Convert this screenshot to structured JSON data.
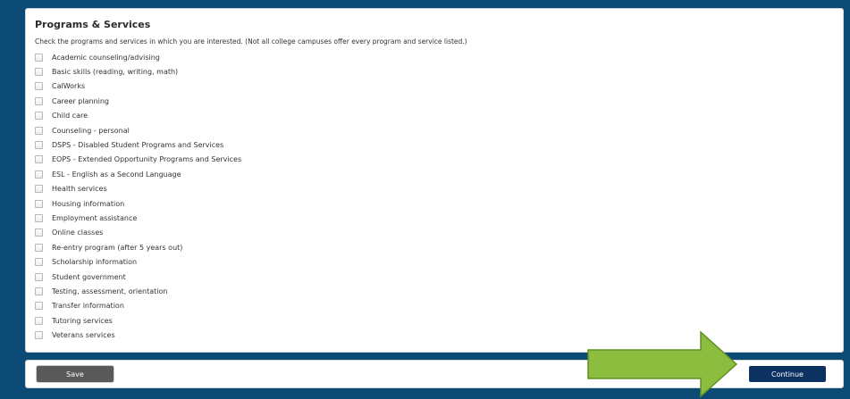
{
  "section": {
    "title": "Programs & Services",
    "intro": "Check the programs and services in which you are interested. (Not all college campuses offer every program and service listed.)",
    "options": [
      "Academic counseling/advising",
      "Basic skills (reading, writing, math)",
      "CalWorks",
      "Career planning",
      "Child care",
      "Counseling - personal",
      "DSPS - Disabled Student Programs and Services",
      "EOPS - Extended Opportunity Programs and Services",
      "ESL - English as a Second Language",
      "Health services",
      "Housing information",
      "Employment assistance",
      "Online classes",
      "Re-entry program (after 5 years out)",
      "Scholarship information",
      "Student government",
      "Testing, assessment, orientation",
      "Transfer information",
      "Tutoring services",
      "Veterans services"
    ]
  },
  "footer": {
    "save_label": "Save",
    "continue_label": "Continue"
  },
  "colors": {
    "background": "#0b4a74",
    "continue_button": "#0b3260",
    "save_button": "#595959",
    "annotation_arrow": "#8cbd3f"
  },
  "annotation": {
    "icon": "right-arrow-icon"
  }
}
